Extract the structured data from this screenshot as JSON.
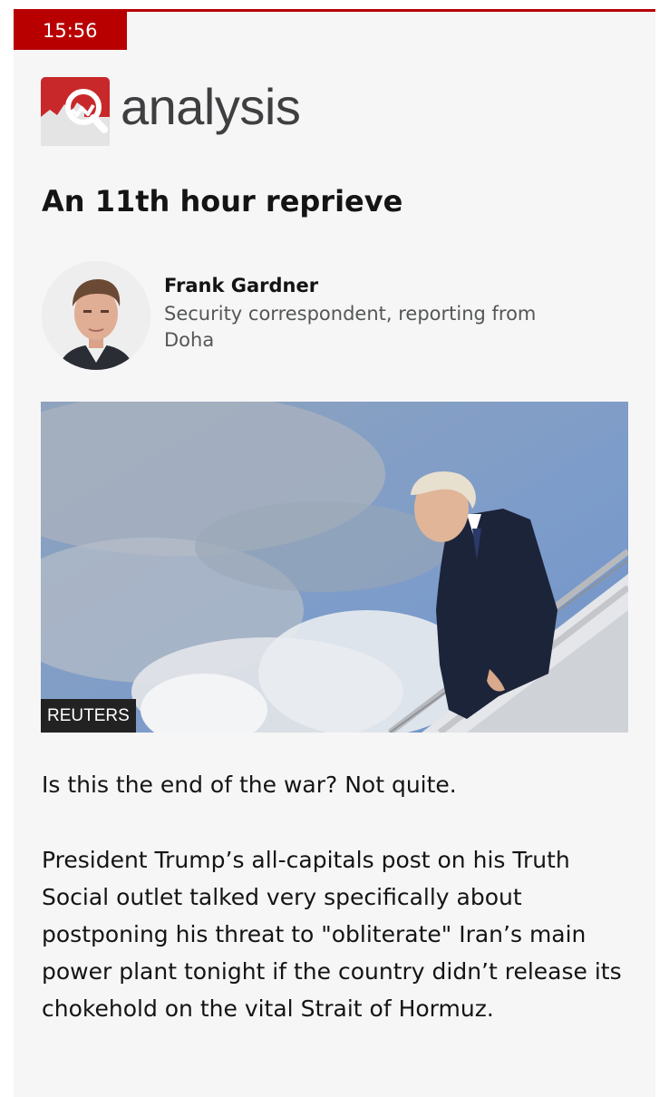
{
  "page": {
    "time": "15:56",
    "label": "analysis",
    "headline": "An 11th hour reprieve"
  },
  "author": {
    "name": "Frank Gardner",
    "role": "Security correspondent, reporting from Doha"
  },
  "image": {
    "credit": "REUTERS"
  },
  "body": {
    "paragraphs": [
      "Is this the end of the war? Not quite.",
      "President Trump’s all-capitals post on his Truth Social outlet talked very specifically about postponing his threat to \"obliterate\" Iran’s main power plant tonight if the country didn’t release its chokehold on the vital Strait of Hormuz."
    ]
  },
  "colors": {
    "accent": "#b80000",
    "card_background": "#f6f6f6",
    "text": "#141414",
    "secondary_text": "#545658"
  },
  "icons": [
    "analysis-magnifier-chart-icon"
  ]
}
